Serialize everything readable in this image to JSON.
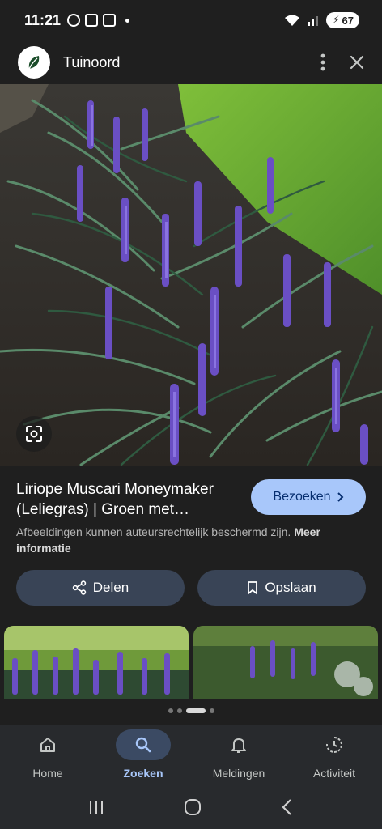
{
  "status_bar": {
    "time": "11:21",
    "battery": "67"
  },
  "header": {
    "site_name": "Tuinoord"
  },
  "result": {
    "title": "Liriope Muscari Moneymaker (Leliegras) | Groen met…",
    "visit_label": "Bezoeken",
    "notice_text": "Afbeeldingen kunnen auteursrechtelijk beschermd zijn.",
    "notice_link": "Meer informatie"
  },
  "actions": {
    "share_label": "Delen",
    "save_label": "Opslaan"
  },
  "pager": {
    "count": 4,
    "active_index": 2
  },
  "bottom_nav": {
    "items": [
      {
        "label": "Home",
        "icon": "home-icon"
      },
      {
        "label": "Zoeken",
        "icon": "search-icon",
        "active": true
      },
      {
        "label": "Meldingen",
        "icon": "bell-icon"
      },
      {
        "label": "Activiteit",
        "icon": "activity-icon"
      }
    ]
  },
  "colors": {
    "accent": "#a8c7fa",
    "background": "#1f1f1f",
    "button": "#394456"
  }
}
